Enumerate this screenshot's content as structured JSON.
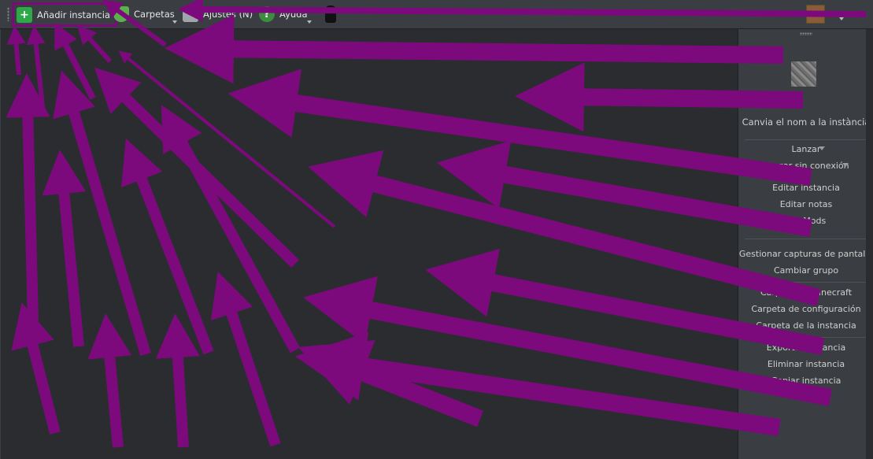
{
  "toolbar": {
    "add_instance": "Añadir instancia",
    "folders": "Carpetas",
    "settings": "Ajustes (N)",
    "help": "Ayuda"
  },
  "sidebar": {
    "rename": "Canvia el nom a la instància",
    "launch": "Lanzar",
    "launch_offline": "Lanzar sin conexión",
    "items": [
      "Editar instancia",
      "Editar notas",
      "Ver Mods",
      "Gestionar capturas de pantalla",
      "Cambiar grupo",
      "Carpeta de Minecraft",
      "Carpeta de configuración",
      "Carpeta de la instancia",
      "Exportar instancia",
      "Eliminar instancia",
      "Copiar instancia"
    ]
  },
  "colors": {
    "annotation_arrow": "#7d0a7d",
    "toolbar_bg": "#3a3d42",
    "main_bg": "#2a2c30"
  },
  "icons": [
    "add-instance-icon",
    "folder-icon",
    "settings-icon",
    "help-icon",
    "cat-icon",
    "account-icon"
  ]
}
